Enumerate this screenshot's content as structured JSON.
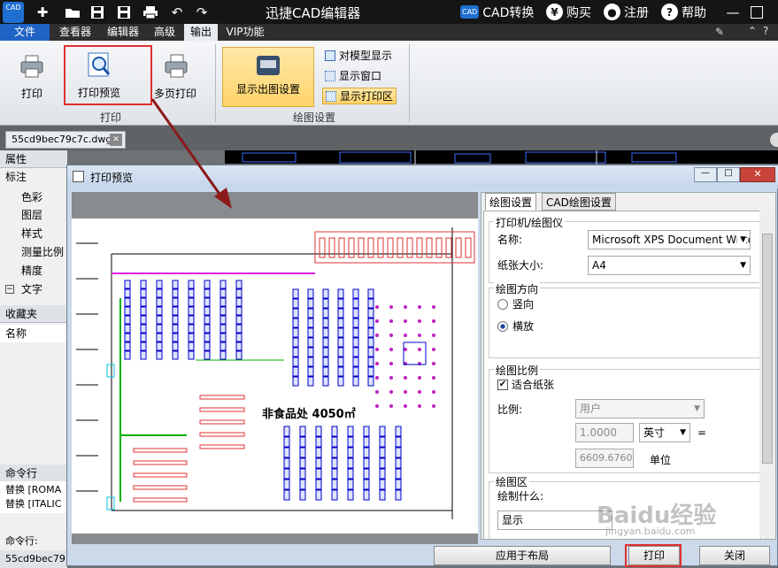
{
  "app": {
    "title": "迅捷CAD编辑器",
    "logo_text": "CAD",
    "cad_convert": "CAD转换",
    "buy": "购买",
    "register": "注册",
    "help": "帮助"
  },
  "menu": [
    "文件",
    "查看器",
    "编辑器",
    "高级",
    "输出",
    "VIP功能"
  ],
  "ribbon": {
    "print": "打印",
    "print_preview": "打印预览",
    "multi_print": "多页打印",
    "print_group": "打印",
    "show_plot_settings": "显示出图设置",
    "to_model_display": "对模型显示",
    "show_window": "显示窗口",
    "show_print_area": "显示打印区",
    "plot_group": "绘图设置"
  },
  "doc_tab": "55cd9bec79c7c.dwg",
  "left_panel": {
    "properties": "属性",
    "annotation": "标注",
    "color": "色彩",
    "layer": "图层",
    "style": "样式",
    "measure_scale": "测量比例",
    "precision": "精度",
    "text": "文字",
    "favorites": "收藏夹",
    "name": "名称",
    "command_line": "命令行",
    "cmd1": "替换 [ROMA",
    "cmd2": "替换 [ITALIC",
    "cmd_prompt": "命令行:",
    "bottom_tab": "55cd9bec79"
  },
  "dialog": {
    "title": "打印预览",
    "drawing_label": "非食品处 4050㎡",
    "tabs": [
      "绘图设置",
      "CAD绘图设置"
    ],
    "printer_group": "打印机/绘图仪",
    "name_label": "名称:",
    "printer_name": "Microsoft XPS Document Writer",
    "paper_size_label": "纸张大小:",
    "paper_size": "A4",
    "orientation_group": "绘图方向",
    "portrait": "竖向",
    "landscape": "横放",
    "scale_group": "绘图比例",
    "fit_paper": "适合纸张",
    "scale_label": "比例:",
    "scale_value": "用户",
    "scale_num": "1.0000",
    "unit_select": "英寸",
    "equals": "=",
    "unit_num": "6609.6760",
    "unit_label": "单位",
    "area_group": "绘图区",
    "draw_what": "绘制什么:",
    "draw_what_value": "显示",
    "apply_layout": "应用于布局",
    "print": "打印",
    "close": "关闭"
  },
  "watermark": {
    "text": "Baidu经验",
    "url": "jingyan.baidu.com"
  },
  "colors": {
    "highlight_red": "#e03030",
    "arrow": "#8b1a1a",
    "plan_blue": "#0000c8",
    "plan_green": "#00b000"
  }
}
